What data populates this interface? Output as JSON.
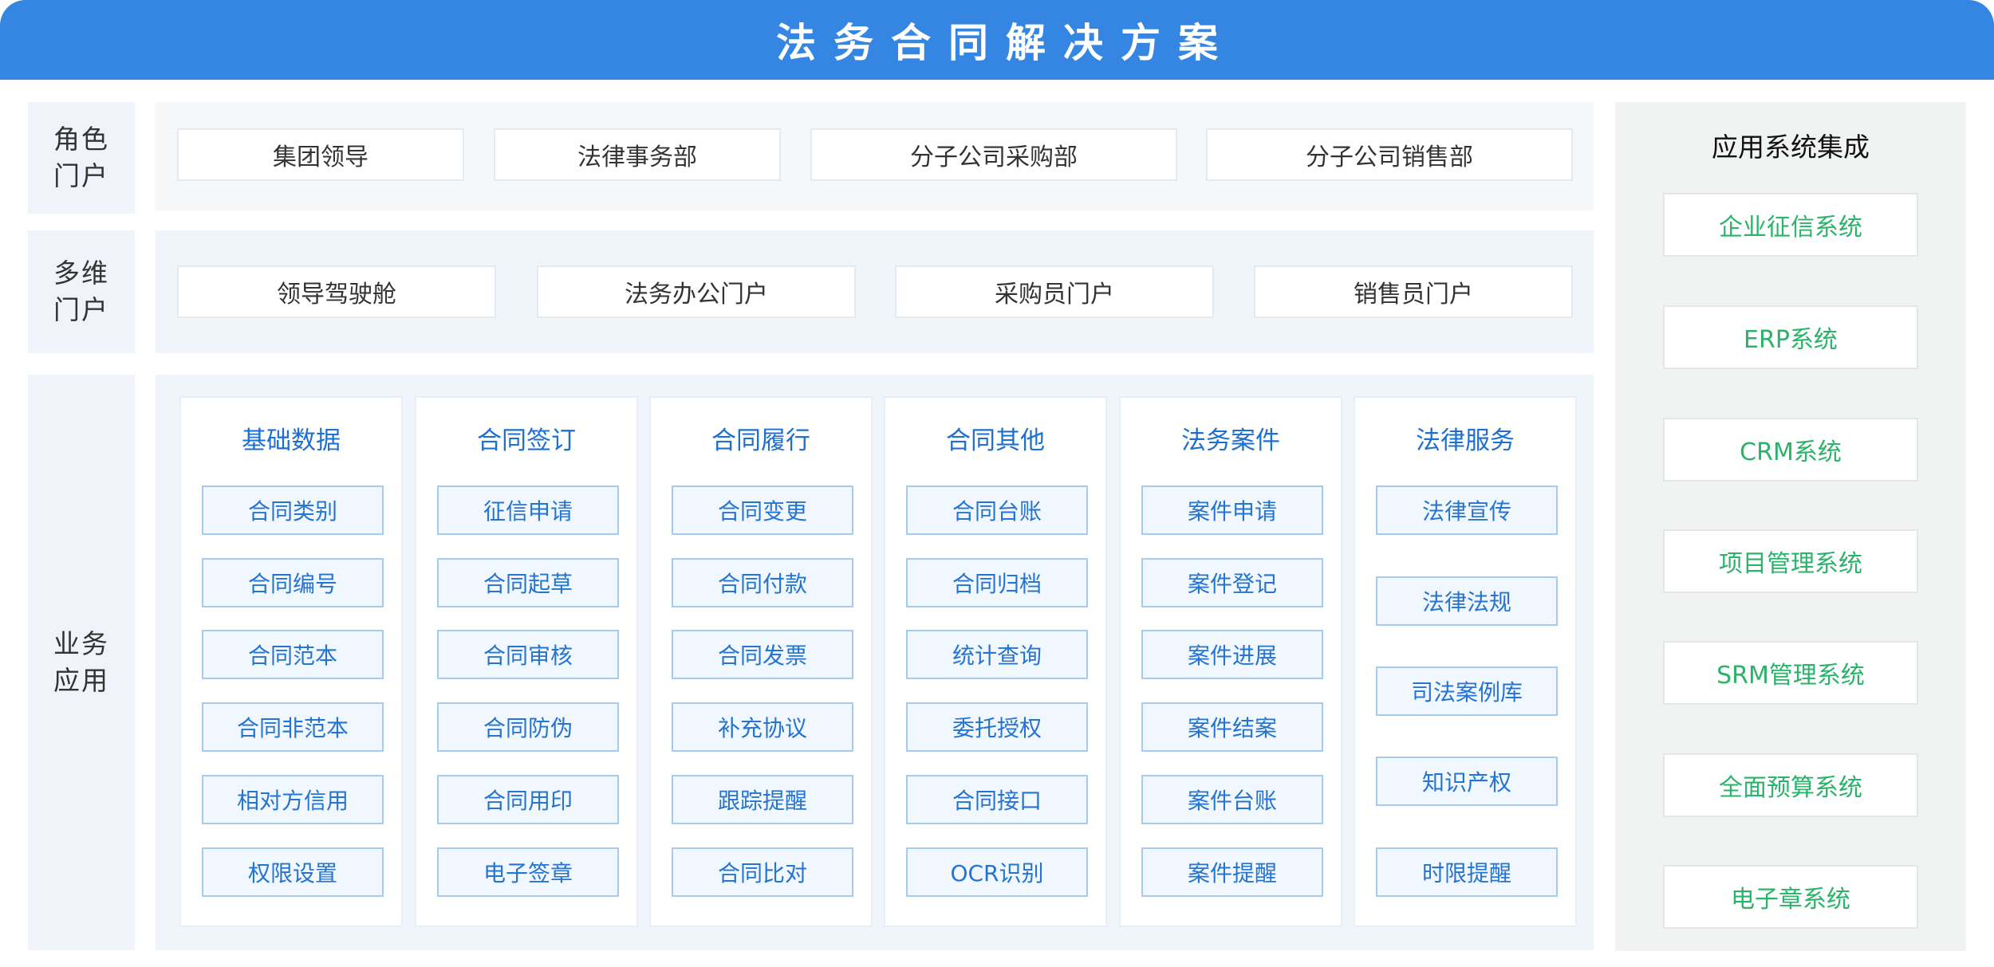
{
  "title": "法务合同解决方案",
  "rows": {
    "role_portal": {
      "label": "角色门户",
      "items": [
        "集团领导",
        "法律事务部",
        "分子公司采购部",
        "分子公司销售部"
      ]
    },
    "multi_portal": {
      "label": "多维门户",
      "items": [
        "领导驾驶舱",
        "法务办公门户",
        "采购员门户",
        "销售员门户"
      ]
    },
    "business": {
      "label": "业务应用",
      "modules": [
        {
          "title": "基础数据",
          "items": [
            "合同类别",
            "合同编号",
            "合同范本",
            "合同非范本",
            "相对方信用",
            "权限设置"
          ]
        },
        {
          "title": "合同签订",
          "items": [
            "征信申请",
            "合同起草",
            "合同审核",
            "合同防伪",
            "合同用印",
            "电子签章"
          ]
        },
        {
          "title": "合同履行",
          "items": [
            "合同变更",
            "合同付款",
            "合同发票",
            "补充协议",
            "跟踪提醒",
            "合同比对"
          ]
        },
        {
          "title": "合同其他",
          "items": [
            "合同台账",
            "合同归档",
            "统计查询",
            "委托授权",
            "合同接口",
            "OCR识别"
          ]
        },
        {
          "title": "法务案件",
          "items": [
            "案件申请",
            "案件登记",
            "案件进展",
            "案件结案",
            "案件台账",
            "案件提醒"
          ]
        },
        {
          "title": "法律服务",
          "items": [
            "法律宣传",
            "法律法规",
            "司法案例库",
            "知识产权",
            "时限提醒"
          ]
        }
      ]
    }
  },
  "integration": {
    "title": "应用系统集成",
    "items": [
      "企业征信系统",
      "ERP系统",
      "CRM系统",
      "项目管理系统",
      "SRM管理系统",
      "全面预算系统",
      "电子章系统"
    ]
  },
  "colors": {
    "header": "#3486e2",
    "module_title": "#1d6fd0",
    "module_item_text": "#2574cf",
    "integration_text": "#2bb36a"
  }
}
